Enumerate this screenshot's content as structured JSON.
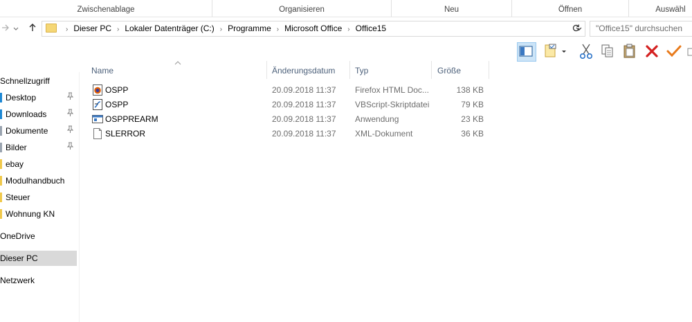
{
  "ribbon": {
    "groups": [
      "Zwischenablage",
      "Organisieren",
      "Neu",
      "Öffnen",
      "Auswähl"
    ]
  },
  "nav": {
    "back_icon": "back-arrow-icon",
    "forward_icon": "forward-arrow-icon",
    "up_icon": "up-arrow-icon"
  },
  "address": {
    "crumbs": [
      "Dieser PC",
      "Lokaler Datenträger (C:)",
      "Programme",
      "Microsoft Office",
      "Office15"
    ]
  },
  "search": {
    "placeholder": "\"Office15\" durchsuchen"
  },
  "toolbar": {
    "icons": [
      "preview-pane-icon",
      "properties-icon",
      "cut-icon",
      "copy-icon",
      "paste-icon",
      "delete-icon",
      "rename-check-icon"
    ],
    "colors": {
      "selected_bg": "#cce4f7",
      "delete": "#d42020",
      "check": "#e87a1b",
      "cut": "#2a72c7"
    }
  },
  "sidebar": {
    "quick_access": "Schnellzugriff",
    "items": [
      {
        "label": "Desktop",
        "pinned": true,
        "color": "#1e88d4"
      },
      {
        "label": "Downloads",
        "pinned": true,
        "color": "#1e88d4"
      },
      {
        "label": "Dokumente",
        "pinned": true,
        "color": "#9aa4b0"
      },
      {
        "label": "Bilder",
        "pinned": true,
        "color": "#9aa4b0"
      },
      {
        "label": "ebay",
        "pinned": false,
        "color": "#f0c94c"
      },
      {
        "label": "Modulhandbuch",
        "pinned": false,
        "color": "#f0c94c"
      },
      {
        "label": "Steuer",
        "pinned": false,
        "color": "#f0c94c"
      },
      {
        "label": "Wohnung KN",
        "pinned": false,
        "color": "#f0c94c"
      }
    ],
    "onedrive": "OneDrive",
    "this_pc": "Dieser PC",
    "network": "Netzwerk"
  },
  "columns": {
    "name": "Name",
    "date": "Änderungsdatum",
    "type": "Typ",
    "size": "Größe"
  },
  "files": [
    {
      "name": "OSPP",
      "date": "20.09.2018 11:37",
      "type": "Firefox HTML Doc...",
      "size": "138 KB",
      "icon": "firefox-html-icon"
    },
    {
      "name": "OSPP",
      "date": "20.09.2018 11:37",
      "type": "VBScript-Skriptdatei",
      "size": "79 KB",
      "icon": "vbscript-icon"
    },
    {
      "name": "OSPPREARM",
      "date": "20.09.2018 11:37",
      "type": "Anwendung",
      "size": "23 KB",
      "icon": "application-icon"
    },
    {
      "name": "SLERROR",
      "date": "20.09.2018 11:37",
      "type": "XML-Dokument",
      "size": "36 KB",
      "icon": "xml-document-icon"
    }
  ]
}
